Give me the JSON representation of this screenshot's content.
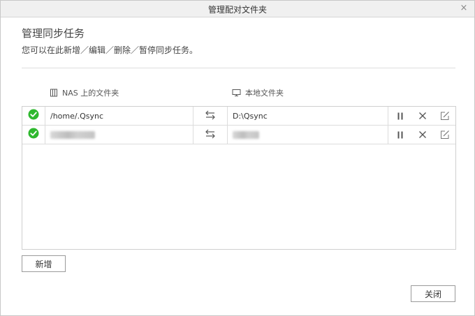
{
  "window": {
    "title": "管理配对文件夹",
    "close_glyph": "×"
  },
  "main": {
    "heading": "管理同步任务",
    "subtitle": "您可以在此新增／编辑／删除／暂停同步任务。"
  },
  "columns": {
    "nas_label": "NAS 上的文件夹",
    "local_label": "本地文件夹"
  },
  "tasks": [
    {
      "status": "ok",
      "nas_folder": "/home/.Qsync",
      "local_folder": "D:\\Qsync"
    },
    {
      "status": "ok",
      "nas_folder": "",
      "local_folder": ""
    }
  ],
  "buttons": {
    "add_label": "新增",
    "close_label": "关闭"
  },
  "colors": {
    "status_ok": "#2eb82e",
    "icon_gray": "#555555"
  }
}
